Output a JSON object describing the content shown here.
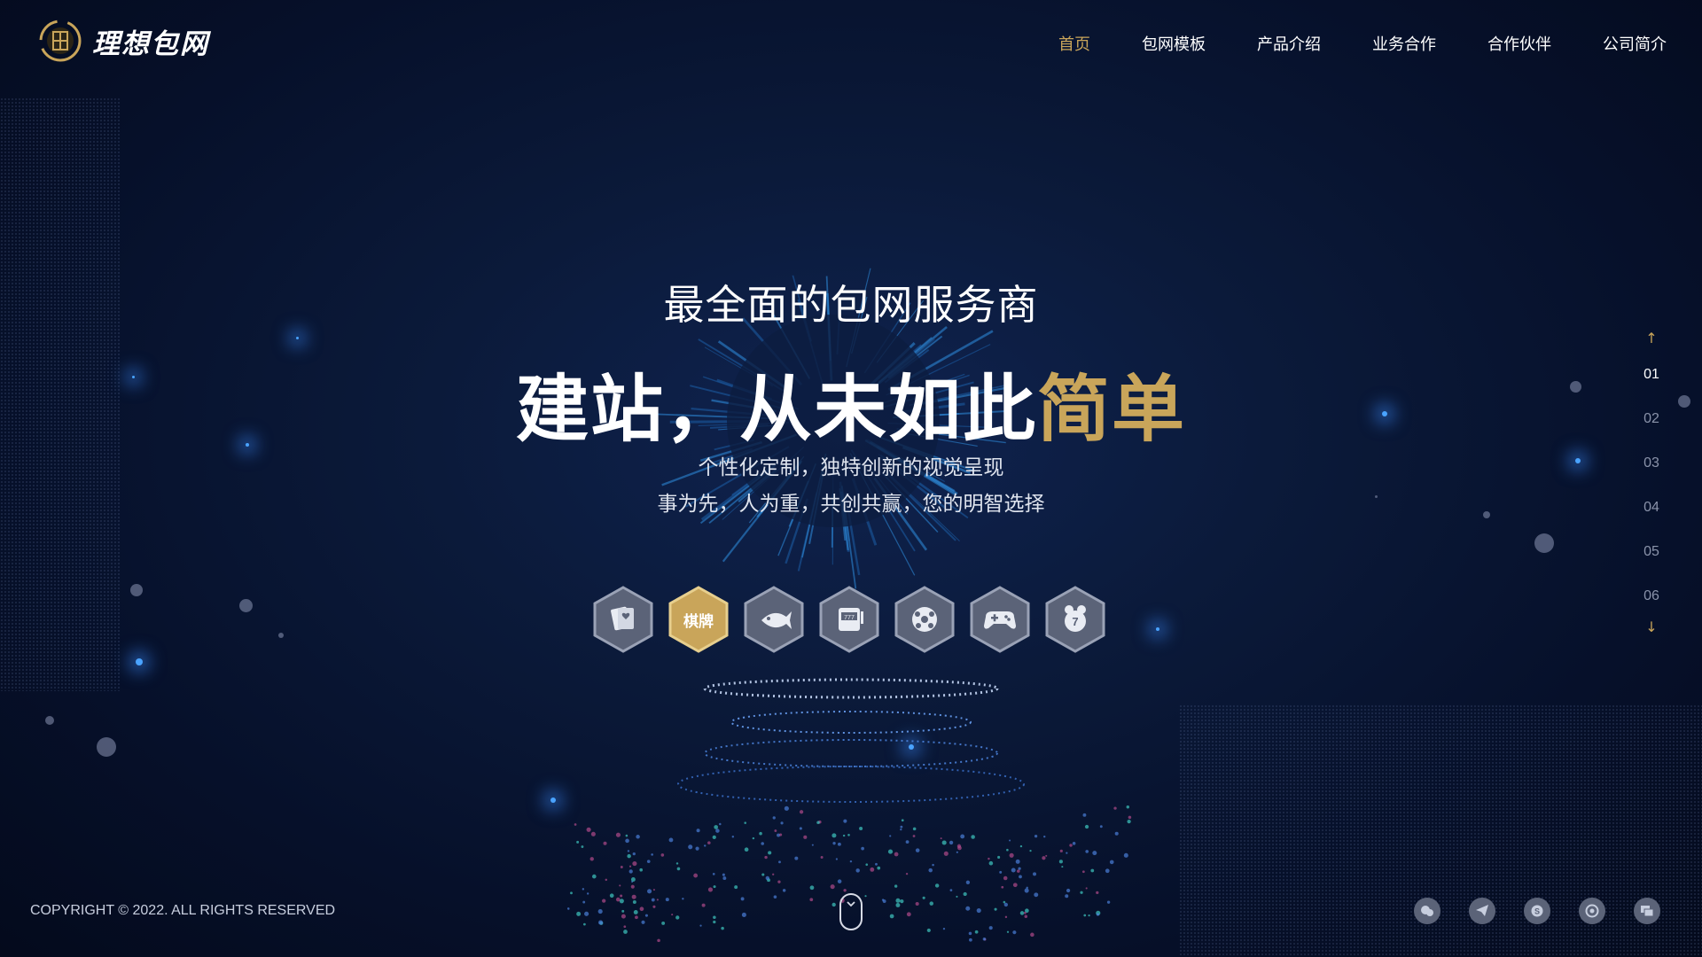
{
  "brand": {
    "name": "理想包网",
    "logo_mark": "logo-mark"
  },
  "nav": {
    "items": [
      {
        "label": "首页",
        "active": true
      },
      {
        "label": "包网模板",
        "active": false
      },
      {
        "label": "产品介绍",
        "active": false
      },
      {
        "label": "业务合作",
        "active": false
      },
      {
        "label": "合作伙伴",
        "active": false
      },
      {
        "label": "公司简介",
        "active": false
      }
    ]
  },
  "hero": {
    "subtitle": "最全面的包网服务商",
    "title_main": "建站，从未如此",
    "title_accent": "简单",
    "line1": "个性化定制，独特创新的视觉呈现",
    "line2": "事为先，人为重，共创共赢，您的明智选择"
  },
  "categories": [
    {
      "icon": "cards-icon",
      "label": "",
      "active": false
    },
    {
      "icon": "chess-card-icon",
      "label": "棋牌",
      "active": true
    },
    {
      "icon": "fish-icon",
      "label": "",
      "active": false
    },
    {
      "icon": "slot-machine-icon",
      "label": "",
      "active": false
    },
    {
      "icon": "soccer-ball-icon",
      "label": "",
      "active": false
    },
    {
      "icon": "gamepad-icon",
      "label": "",
      "active": false
    },
    {
      "icon": "lottery-ball-icon",
      "label": "",
      "active": false
    }
  ],
  "pager": {
    "up_icon": "arrow-up-icon",
    "down_icon": "arrow-down-icon",
    "pages": [
      "01",
      "02",
      "03",
      "04",
      "05",
      "06"
    ],
    "active_index": 0
  },
  "footer": {
    "copyright": "COPYRIGHT © 2022. ALL RIGHTS RESERVED",
    "scroll_icon": "mouse-scroll-icon",
    "socials": [
      "wechat-icon",
      "telegram-icon",
      "skype-icon",
      "whatsapp-icon",
      "chat-icon"
    ]
  },
  "colors": {
    "accent": "#c9a55a",
    "background": "#0b1a3a",
    "social_bg": "#5b6378"
  }
}
